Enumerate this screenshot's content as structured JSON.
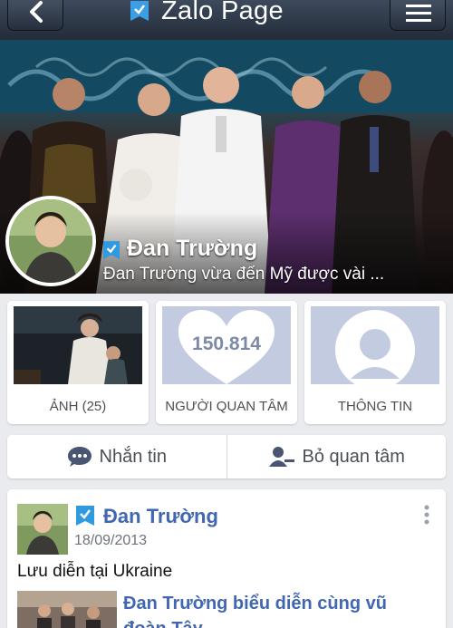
{
  "header": {
    "title": "Zalo Page",
    "back_icon": "chevron-left-icon",
    "menu_icon": "hamburger-menu-icon",
    "verified_icon": "verified-badge-icon"
  },
  "profile": {
    "name": "Đan Trường",
    "status": "Đan Trường vừa đến Mỹ được vài ..."
  },
  "tiles": {
    "photos_label": "ẢNH (25)",
    "followers_count": "150.814",
    "followers_label": "NGƯỜI QUAN TÂM",
    "info_label": "THÔNG TIN"
  },
  "actions": {
    "message_label": "Nhắn tin",
    "unfollow_label": "Bỏ quan tâm"
  },
  "post": {
    "author": "Đan Trường",
    "date": "18/09/2013",
    "text": "Lưu diễn tại Ukraine",
    "link_title": "Đan Trường biểu diễn cùng vũ đoàn Tây"
  },
  "colors": {
    "nav_bar": "#2d3644",
    "link_blue": "#4267b2",
    "verified_blue": "#2f9ae0",
    "placeholder": "#c3cbe0"
  }
}
